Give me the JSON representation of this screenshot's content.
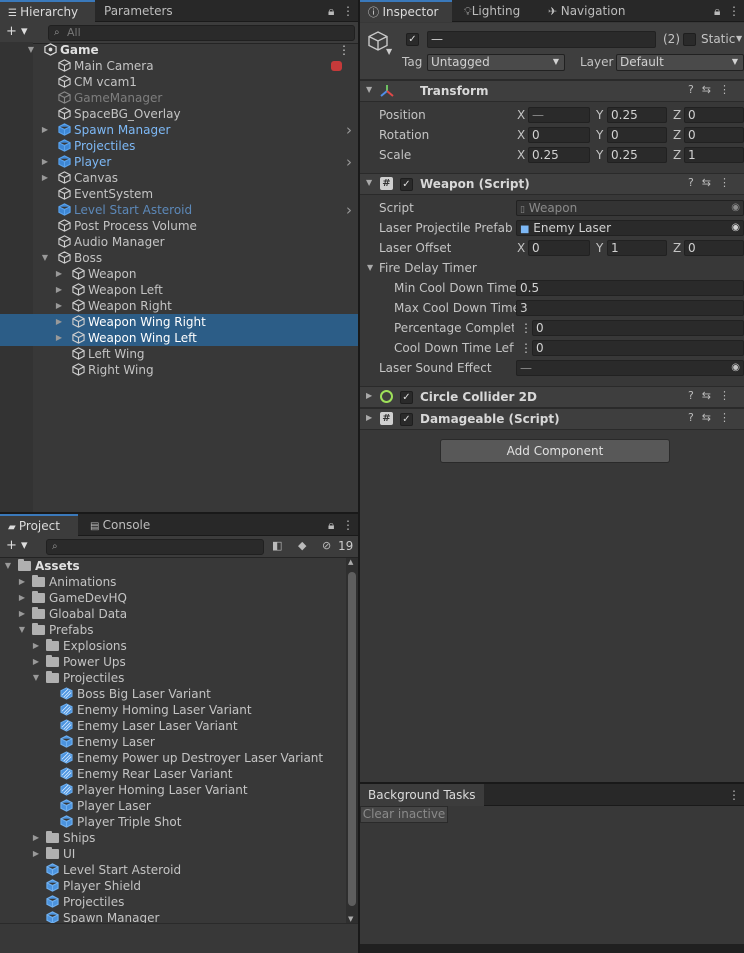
{
  "hierarchy": {
    "tabs": [
      "Hierarchy",
      "Parameters"
    ],
    "search_placeholder": "All",
    "add_label": "+ ▾",
    "rows": [
      {
        "label": "Game",
        "indent": 0,
        "arrow": "down",
        "icon": "unity",
        "style": "bold",
        "selected": false,
        "right_arrow": false,
        "rec": false
      },
      {
        "label": "Main Camera",
        "indent": 1,
        "arrow": "",
        "icon": "cube",
        "style": "normal",
        "selected": false,
        "right_arrow": false,
        "rec": true
      },
      {
        "label": "CM vcam1",
        "indent": 1,
        "arrow": "",
        "icon": "cube",
        "style": "normal",
        "selected": false,
        "right_arrow": false,
        "rec": false
      },
      {
        "label": "GameManager",
        "indent": 1,
        "arrow": "",
        "icon": "cube",
        "style": "grey",
        "selected": false,
        "right_arrow": false,
        "rec": false
      },
      {
        "label": "SpaceBG_Overlay",
        "indent": 1,
        "arrow": "",
        "icon": "cube",
        "style": "normal",
        "selected": false,
        "right_arrow": false,
        "rec": false
      },
      {
        "label": "Spawn Manager",
        "indent": 1,
        "arrow": "right",
        "icon": "bluecube",
        "style": "blue",
        "selected": false,
        "right_arrow": true,
        "rec": false
      },
      {
        "label": "Projectiles",
        "indent": 1,
        "arrow": "",
        "icon": "bluecube",
        "style": "blue",
        "selected": false,
        "right_arrow": false,
        "rec": false
      },
      {
        "label": "Player",
        "indent": 1,
        "arrow": "right",
        "icon": "bluecube",
        "style": "blue",
        "selected": false,
        "right_arrow": true,
        "rec": false
      },
      {
        "label": "Canvas",
        "indent": 1,
        "arrow": "right",
        "icon": "cube",
        "style": "normal",
        "selected": false,
        "right_arrow": false,
        "rec": false
      },
      {
        "label": "EventSystem",
        "indent": 1,
        "arrow": "",
        "icon": "cube",
        "style": "normal",
        "selected": false,
        "right_arrow": false,
        "rec": false
      },
      {
        "label": "Level Start Asteroid",
        "indent": 1,
        "arrow": "",
        "icon": "bluecube",
        "style": "greyblue",
        "selected": false,
        "right_arrow": true,
        "rec": false
      },
      {
        "label": "Post Process Volume",
        "indent": 1,
        "arrow": "",
        "icon": "cube",
        "style": "normal",
        "selected": false,
        "right_arrow": false,
        "rec": false
      },
      {
        "label": "Audio Manager",
        "indent": 1,
        "arrow": "",
        "icon": "cube",
        "style": "normal",
        "selected": false,
        "right_arrow": false,
        "rec": false
      },
      {
        "label": "Boss",
        "indent": 1,
        "arrow": "down",
        "icon": "cube",
        "style": "normal",
        "selected": false,
        "right_arrow": false,
        "rec": false
      },
      {
        "label": "Weapon",
        "indent": 2,
        "arrow": "right",
        "icon": "cube",
        "style": "normal",
        "selected": false,
        "right_arrow": false,
        "rec": false
      },
      {
        "label": "Weapon Left",
        "indent": 2,
        "arrow": "right",
        "icon": "cube",
        "style": "normal",
        "selected": false,
        "right_arrow": false,
        "rec": false
      },
      {
        "label": "Weapon Right",
        "indent": 2,
        "arrow": "right",
        "icon": "cube",
        "style": "normal",
        "selected": false,
        "right_arrow": false,
        "rec": false
      },
      {
        "label": "Weapon Wing Right",
        "indent": 2,
        "arrow": "right",
        "icon": "cube",
        "style": "normal",
        "selected": true,
        "right_arrow": false,
        "rec": false
      },
      {
        "label": "Weapon Wing Left",
        "indent": 2,
        "arrow": "right",
        "icon": "cube",
        "style": "normal",
        "selected": true,
        "right_arrow": false,
        "rec": false
      },
      {
        "label": "Left Wing",
        "indent": 2,
        "arrow": "",
        "icon": "cube",
        "style": "normal",
        "selected": false,
        "right_arrow": false,
        "rec": false
      },
      {
        "label": "Right Wing",
        "indent": 2,
        "arrow": "",
        "icon": "cube",
        "style": "normal",
        "selected": false,
        "right_arrow": false,
        "rec": false
      }
    ]
  },
  "project": {
    "tabs": [
      "Project",
      "Console"
    ],
    "add_label": "+ ▾",
    "hidden_count": "19",
    "rows": [
      {
        "label": "Assets",
        "indent": 0,
        "arrow": "down",
        "icon": "folder",
        "style": "bold"
      },
      {
        "label": "Animations",
        "indent": 1,
        "arrow": "right",
        "icon": "folder",
        "style": "normal"
      },
      {
        "label": "GameDevHQ",
        "indent": 1,
        "arrow": "right",
        "icon": "folder",
        "style": "normal"
      },
      {
        "label": "Gloabal Data",
        "indent": 1,
        "arrow": "right",
        "icon": "folder",
        "style": "normal"
      },
      {
        "label": "Prefabs",
        "indent": 1,
        "arrow": "down",
        "icon": "folder",
        "style": "normal"
      },
      {
        "label": "Explosions",
        "indent": 2,
        "arrow": "right",
        "icon": "folder",
        "style": "normal"
      },
      {
        "label": "Power Ups",
        "indent": 2,
        "arrow": "right",
        "icon": "folder",
        "style": "normal"
      },
      {
        "label": "Projectiles",
        "indent": 2,
        "arrow": "down",
        "icon": "folder",
        "style": "normal"
      },
      {
        "label": "Boss Big Laser Variant",
        "indent": 3,
        "arrow": "",
        "icon": "variant",
        "style": "normal"
      },
      {
        "label": "Enemy Homing Laser Variant",
        "indent": 3,
        "arrow": "",
        "icon": "variant",
        "style": "normal"
      },
      {
        "label": "Enemy Laser Laser Variant",
        "indent": 3,
        "arrow": "",
        "icon": "variant",
        "style": "normal"
      },
      {
        "label": "Enemy Laser",
        "indent": 3,
        "arrow": "",
        "icon": "prefab",
        "style": "normal"
      },
      {
        "label": "Enemy Power up Destroyer Laser Variant",
        "indent": 3,
        "arrow": "",
        "icon": "variant",
        "style": "normal"
      },
      {
        "label": "Enemy Rear Laser Variant",
        "indent": 3,
        "arrow": "",
        "icon": "variant",
        "style": "normal"
      },
      {
        "label": "Player Homing Laser Variant",
        "indent": 3,
        "arrow": "",
        "icon": "variant",
        "style": "normal"
      },
      {
        "label": "Player Laser",
        "indent": 3,
        "arrow": "",
        "icon": "prefab",
        "style": "normal"
      },
      {
        "label": "Player Triple Shot",
        "indent": 3,
        "arrow": "",
        "icon": "prefab",
        "style": "normal"
      },
      {
        "label": "Ships",
        "indent": 2,
        "arrow": "right",
        "icon": "folder",
        "style": "normal"
      },
      {
        "label": "UI",
        "indent": 2,
        "arrow": "right",
        "icon": "folder",
        "style": "normal"
      },
      {
        "label": "Level Start Asteroid",
        "indent": 2,
        "arrow": "",
        "icon": "prefab",
        "style": "normal"
      },
      {
        "label": "Player Shield",
        "indent": 2,
        "arrow": "",
        "icon": "prefab",
        "style": "normal"
      },
      {
        "label": "Projectiles",
        "indent": 2,
        "arrow": "",
        "icon": "prefab",
        "style": "normal"
      },
      {
        "label": "Spawn Manager",
        "indent": 2,
        "arrow": "",
        "icon": "prefab",
        "style": "normal"
      }
    ]
  },
  "inspector": {
    "tabs": [
      "Inspector",
      "Lighting",
      "Navigation"
    ],
    "object_name": "—",
    "count": "(2)",
    "static_label": "Static",
    "tag_label": "Tag",
    "tag_value": "Untagged",
    "layer_label": "Layer",
    "layer_value": "Default",
    "transform": {
      "title": "Transform",
      "rows": [
        {
          "label": "Position",
          "x": "—",
          "y": "0.25",
          "z": "0"
        },
        {
          "label": "Rotation",
          "x": "0",
          "y": "0",
          "z": "0"
        },
        {
          "label": "Scale",
          "x": "0.25",
          "y": "0.25",
          "z": "1"
        }
      ]
    },
    "weapon": {
      "title": "Weapon (Script)",
      "script_label": "Script",
      "script_value": "Weapon",
      "prefab_label": "Laser Projectile Prefab",
      "prefab_value": "Enemy Laser",
      "offset_label": "Laser Offset",
      "offset": {
        "x": "0",
        "y": "1",
        "z": "0"
      },
      "fire_delay_label": "Fire Delay Timer",
      "min_label": "Min Cool Down Time",
      "min_value": "0.5",
      "max_label": "Max Cool Down Time",
      "max_value": "3",
      "pct_label": "Percentage Complete",
      "pct_value": "0",
      "left_label": "Cool Down Time Left",
      "left_value": "0",
      "sound_label": "Laser Sound Effect",
      "sound_value": "—"
    },
    "circle_title": "Circle Collider 2D",
    "damageable_title": "Damageable (Script)",
    "add_component": "Add Component"
  },
  "background": {
    "tab": "Background Tasks",
    "clear_label": "Clear inactive"
  },
  "colors": {
    "selection": "#2c5d87",
    "prefab_blue": "#7db8f5",
    "accent": "#3a79bb"
  }
}
